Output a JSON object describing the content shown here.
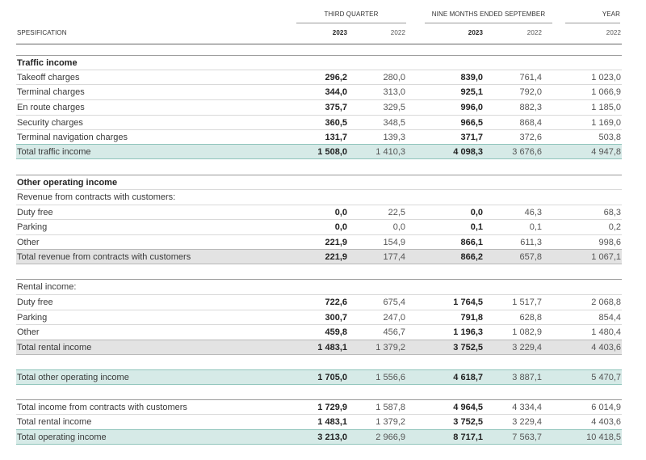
{
  "header": {
    "third_quarter": "THIRD QUARTER",
    "nine_months": "NINE MONTHS ENDED SEPTEMBER",
    "year": "YEAR",
    "spec": "SPESIFICATION",
    "y2023a": "2023",
    "y2022a": "2022",
    "y2023b": "2023",
    "y2022b": "2022",
    "y2022c": "2022"
  },
  "rows": {
    "traffic_title": {
      "label": "Traffic income"
    },
    "takeoff": {
      "label": "Takeoff charges",
      "q23": "296,2",
      "q22": "280,0",
      "n23": "839,0",
      "n22": "761,4",
      "y22": "1 023,0"
    },
    "terminal": {
      "label": "Terminal charges",
      "q23": "344,0",
      "q22": "313,0",
      "n23": "925,1",
      "n22": "792,0",
      "y22": "1 066,9"
    },
    "enroute": {
      "label": "En route charges",
      "q23": "375,7",
      "q22": "329,5",
      "n23": "996,0",
      "n22": "882,3",
      "y22": "1 185,0"
    },
    "security": {
      "label": "Security charges",
      "q23": "360,5",
      "q22": "348,5",
      "n23": "966,5",
      "n22": "868,4",
      "y22": "1 169,0"
    },
    "termnav": {
      "label": "Terminal navigation charges",
      "q23": "131,7",
      "q22": "139,3",
      "n23": "371,7",
      "n22": "372,6",
      "y22": "503,8"
    },
    "total_traffic": {
      "label": "Total traffic income",
      "q23": "1 508,0",
      "q22": "1 410,3",
      "n23": "4 098,3",
      "n22": "3 676,6",
      "y22": "4 947,8"
    },
    "other_title": {
      "label": "Other operating income"
    },
    "rev_contracts_title": {
      "label": "Revenue from contracts with customers:"
    },
    "rc_dutyfree": {
      "label": "Duty free",
      "q23": "0,0",
      "q22": "22,5",
      "n23": "0,0",
      "n22": "46,3",
      "y22": "68,3"
    },
    "rc_parking": {
      "label": "Parking",
      "q23": "0,0",
      "q22": "0,0",
      "n23": "0,1",
      "n22": "0,1",
      "y22": "0,2"
    },
    "rc_other": {
      "label": "Other",
      "q23": "221,9",
      "q22": "154,9",
      "n23": "866,1",
      "n22": "611,3",
      "y22": "998,6"
    },
    "total_rc": {
      "label": "Total revenue from contracts with customers",
      "q23": "221,9",
      "q22": "177,4",
      "n23": "866,2",
      "n22": "657,8",
      "y22": "1 067,1"
    },
    "rental_title": {
      "label": "Rental income:"
    },
    "r_dutyfree": {
      "label": "Duty free",
      "q23": "722,6",
      "q22": "675,4",
      "n23": "1 764,5",
      "n22": "1 517,7",
      "y22": "2 068,8"
    },
    "r_parking": {
      "label": "Parking",
      "q23": "300,7",
      "q22": "247,0",
      "n23": "791,8",
      "n22": "628,8",
      "y22": "854,4"
    },
    "r_other": {
      "label": "Other",
      "q23": "459,8",
      "q22": "456,7",
      "n23": "1 196,3",
      "n22": "1 082,9",
      "y22": "1 480,4"
    },
    "total_rental": {
      "label": "Total rental income",
      "q23": "1 483,1",
      "q22": "1 379,2",
      "n23": "3 752,5",
      "n22": "3 229,4",
      "y22": "4 403,6"
    },
    "total_other_op": {
      "label": "Total other operating income",
      "q23": "1 705,0",
      "q22": "1 556,6",
      "n23": "4 618,7",
      "n22": "3 887,1",
      "y22": "5 470,7"
    },
    "s_contracts": {
      "label": "Total income from contracts with customers",
      "q23": "1 729,9",
      "q22": "1 587,8",
      "n23": "4 964,5",
      "n22": "4 334,4",
      "y22": "6 014,9"
    },
    "s_rental": {
      "label": "Total rental income",
      "q23": "1 483,1",
      "q22": "1 379,2",
      "n23": "3 752,5",
      "n22": "3 229,4",
      "y22": "4 403,6"
    },
    "s_operating": {
      "label": "Total operating income",
      "q23": "3 213,0",
      "q22": "2 966,9",
      "n23": "8 717,1",
      "n22": "7 563,7",
      "y22": "10 418,5"
    }
  },
  "colors": {
    "teal_total": "#d6eae7",
    "grey_total": "#e3e3e3"
  }
}
